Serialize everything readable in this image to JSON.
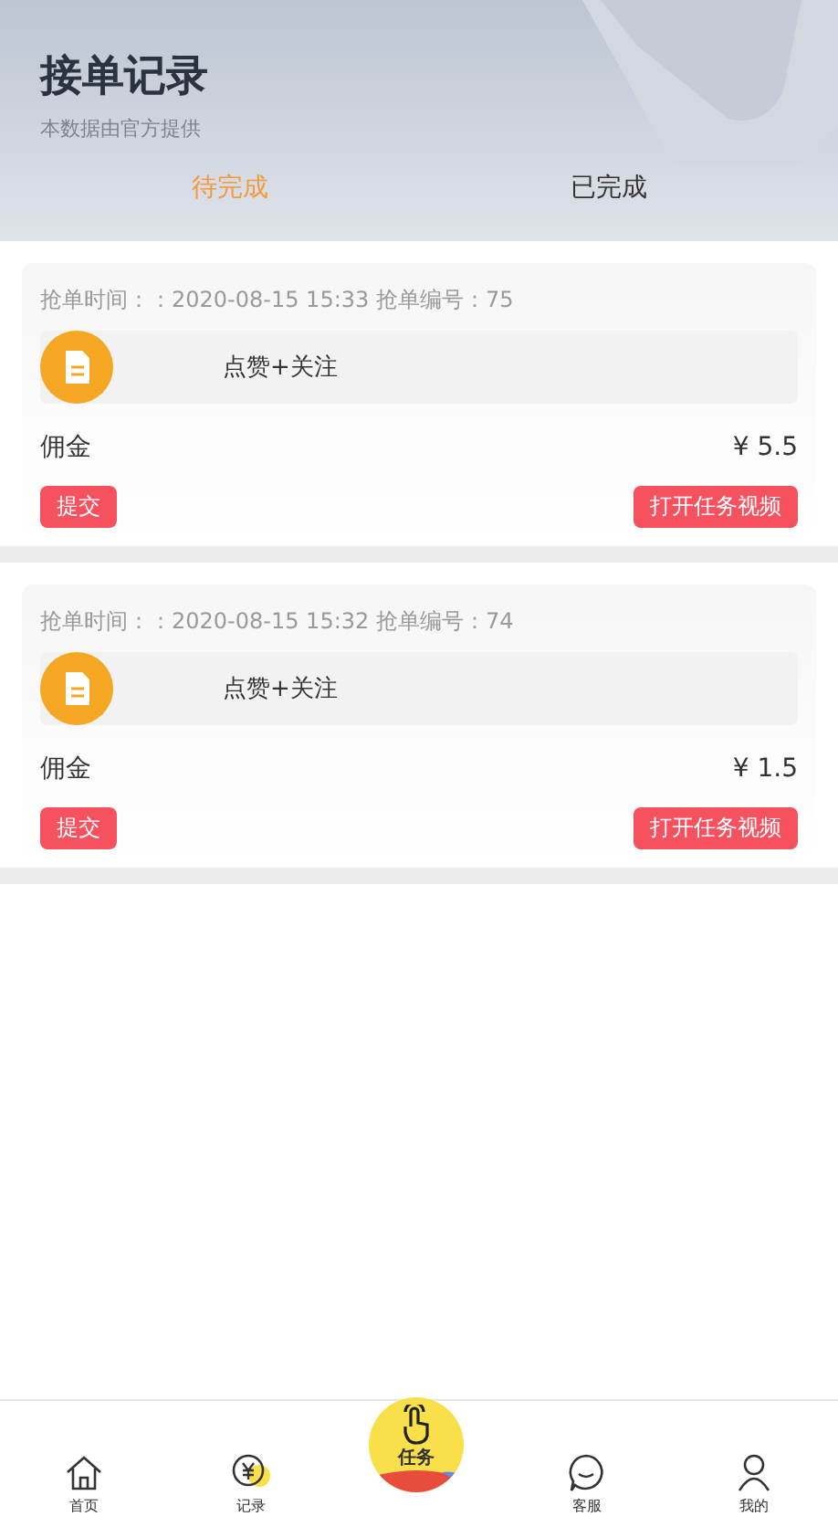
{
  "header": {
    "title": "接单记录",
    "subtitle": "本数据由官方提供"
  },
  "tabs": [
    {
      "label": "待完成",
      "selected": true
    },
    {
      "label": "已完成",
      "selected": false
    }
  ],
  "orders": [
    {
      "meta": "抢单时间：：2020-08-15 15:33 抢单编号：75",
      "task": "点赞+关注",
      "commission_label": "佣金",
      "amount": "¥ 5.5",
      "submit": "提交",
      "open": "打开任务视频"
    },
    {
      "meta": "抢单时间：：2020-08-15 15:32 抢单编号：74",
      "task": "点赞+关注",
      "commission_label": "佣金",
      "amount": "¥ 1.5",
      "submit": "提交",
      "open": "打开任务视频"
    }
  ],
  "nav": [
    {
      "kind": "home",
      "label": "首页"
    },
    {
      "kind": "records",
      "label": "记录"
    },
    {
      "kind": "center",
      "label": "任务"
    },
    {
      "kind": "service",
      "label": "客服"
    },
    {
      "kind": "profile",
      "label": "我的"
    }
  ]
}
